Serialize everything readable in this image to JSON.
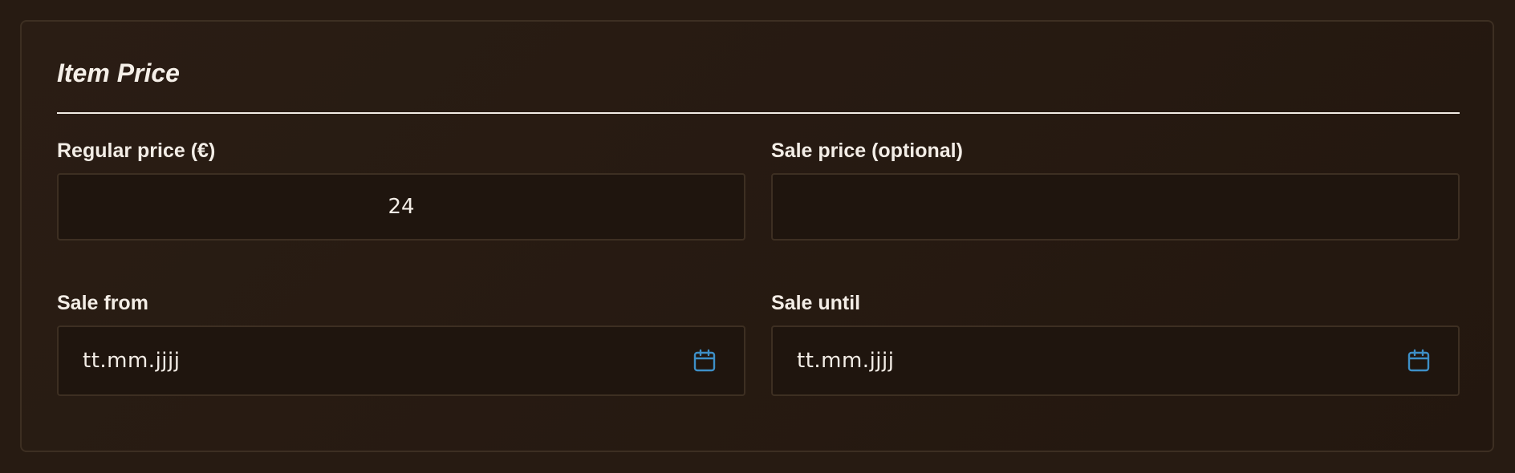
{
  "card": {
    "title": "Item Price"
  },
  "fields": {
    "regular_price": {
      "label": "Regular price (€)",
      "value": "24"
    },
    "sale_price": {
      "label": "Sale price (optional)",
      "value": ""
    },
    "sale_from": {
      "label": "Sale from",
      "placeholder": "tt.mm.jjjj",
      "icon": "calendar-icon"
    },
    "sale_until": {
      "label": "Sale until",
      "placeholder": "tt.mm.jjjj",
      "icon": "calendar-icon"
    }
  },
  "colors": {
    "background": "#271b12",
    "card_border": "#3d2f22",
    "field_background": "#1f150e",
    "text": "#f3ede6",
    "icon_accent": "#3d8fc7"
  }
}
